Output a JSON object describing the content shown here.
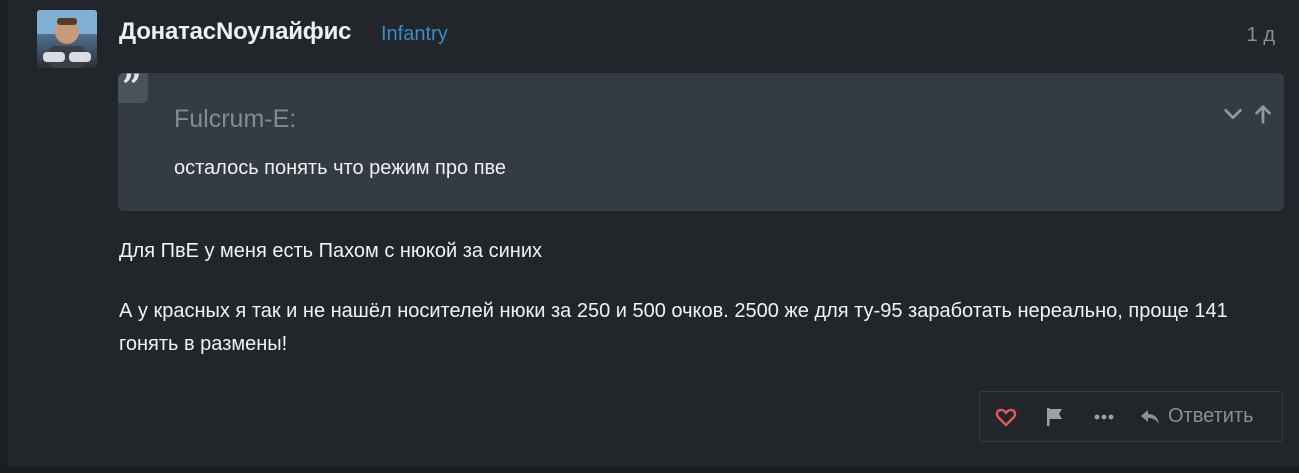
{
  "post": {
    "author": "ДонатасNоулайфис",
    "flair": "Infantry",
    "date": "1 д",
    "avatar_icon": "gamer-avatar",
    "quote": {
      "author": "Fulcrum-E:",
      "text": "осталось понять что режим про пве",
      "icons": [
        "quote-icon",
        "chevron-down-icon",
        "arrow-up-icon"
      ]
    },
    "paragraphs": [
      "Для ПвЕ у меня есть Пахом с нюкой за синих",
      "А у красных я так и не нашёл носителей нюки за 250 и 500 очков. 2500 же для ту-95 заработать нереально, проще 141 гонять в размены!"
    ]
  },
  "actions": {
    "like_icon": "heart-icon",
    "flag_icon": "flag-icon",
    "more_icon": "ellipsis-icon",
    "reply_icon": "reply-icon",
    "reply_label": "Ответить"
  },
  "colors": {
    "background": "#22262b",
    "quote_background": "#353b42",
    "flair": "#3a8cc4",
    "like": "#e45756",
    "muted": "#8a8f96"
  }
}
